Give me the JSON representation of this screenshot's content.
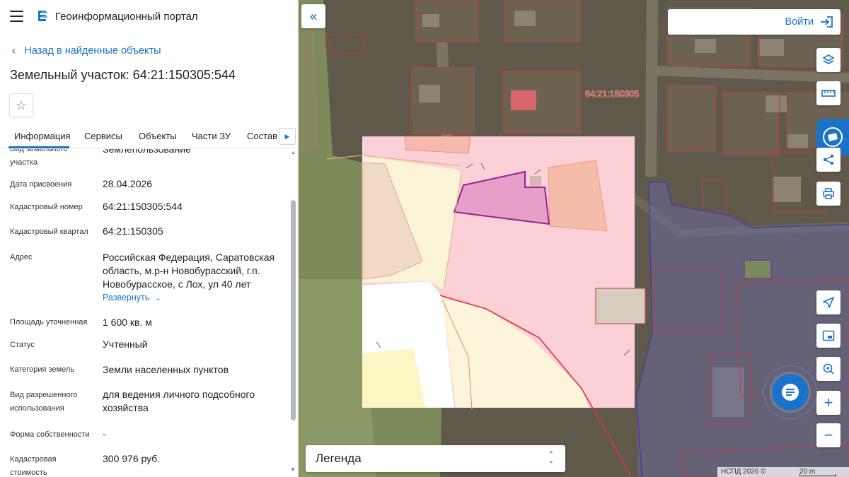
{
  "header": {
    "app_title": "Геоинформационный портал"
  },
  "nav": {
    "back_label": "Назад в найденные объекты"
  },
  "object": {
    "title": "Земельный участок: 64:21:150305:544"
  },
  "tabs": [
    {
      "label": "Информация"
    },
    {
      "label": "Сервисы"
    },
    {
      "label": "Объекты"
    },
    {
      "label": "Части ЗУ"
    },
    {
      "label": "Состав"
    }
  ],
  "info": {
    "rows": [
      {
        "label": "Вид земельного\nучастка",
        "value": "Землепользование"
      },
      {
        "label": "Дата присвоения",
        "value": "28.04.2026"
      },
      {
        "label": "Кадастровый номер",
        "value": "64:21:150305:544"
      },
      {
        "label": "Кадастровый квартал",
        "value": "64:21:150305"
      },
      {
        "label": "Адрес",
        "value": "Российская Федерация, Саратовская область, м.р-н Новобурасский, г.п. Новобурасское, с Лох, ул 40 лет"
      },
      {
        "label": "Площадь уточненная",
        "value": "1 600 кв. м"
      },
      {
        "label": "Статус",
        "value": "Учтенный"
      },
      {
        "label": "Категория земель",
        "value": "Земли населенных пунктов"
      },
      {
        "label": "Вид разрешенного\nиспользования",
        "value": "для ведения личного подсобного хозяйства"
      },
      {
        "label": "Форма собственности",
        "value": "-"
      },
      {
        "label": "Кадастровая\nстоимость",
        "value": "300 976 руб."
      }
    ],
    "expand_label": "Развернуть"
  },
  "map": {
    "quarter_label": "64:21:150305",
    "login_label": "Войти",
    "legend_label": "Легенда",
    "copyright": "НСПД 2026 ©",
    "scale_label": "20 m",
    "colors": {
      "accent": "#1a73c9",
      "selected_parcel": "#e6a0c8",
      "selected_outline": "#9b1d9b",
      "parcel_outline": "#d9353a",
      "zone_pink": "#f8c9cf",
      "zone_yellow": "#fbf3d8"
    },
    "icons": [
      "layers-icon",
      "ruler-icon",
      "share-icon",
      "print-icon",
      "locate-icon",
      "minimap-icon",
      "geolocation-icon",
      "zoom-in-icon",
      "zoom-out-icon",
      "chat-icon",
      "login-icon",
      "collapse-icon",
      "star-icon"
    ]
  }
}
